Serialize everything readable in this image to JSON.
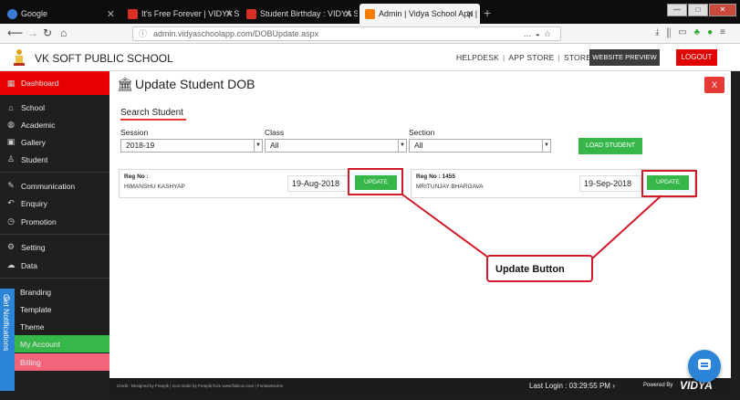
{
  "browser": {
    "tabs": [
      {
        "label": "Google",
        "color": "#3b79d6"
      },
      {
        "label": "It's Free Forever | VIDYA School",
        "color": "#d93025"
      },
      {
        "label": "Student Birthday : VIDYA SCHO",
        "color": "#d93025"
      },
      {
        "label": "Admin | Vidya School App | It's",
        "color": "#f57c00"
      }
    ],
    "new_tab": "+",
    "window_controls": [
      "—",
      "□",
      "✕"
    ],
    "url": "admin.vidyaschoolapp.com/DOBUpdate.aspx"
  },
  "header": {
    "school_name": "VK SOFT PUBLIC SCHOOL",
    "links": [
      "HELPDESK",
      "APP STORE",
      "STORE"
    ],
    "website_preview": "WEBSITE PREVIEW",
    "logout": "LOGOUT"
  },
  "sidebar": {
    "items": [
      {
        "label": "Dashboard",
        "icon": "dashboard-icon"
      },
      {
        "label": "School",
        "icon": "school-icon"
      },
      {
        "label": "Academic",
        "icon": "globe-icon"
      },
      {
        "label": "Gallery",
        "icon": "gallery-icon"
      },
      {
        "label": "Student",
        "icon": "student-icon"
      },
      {
        "label": "Communication",
        "icon": "communication-icon"
      },
      {
        "label": "Enquiry",
        "icon": "enquiry-icon"
      },
      {
        "label": "Promotion",
        "icon": "promotion-icon"
      },
      {
        "label": "Setting",
        "icon": "setting-icon"
      },
      {
        "label": "Data",
        "icon": "data-icon"
      },
      {
        "label": "Branding",
        "icon": "branding-icon"
      },
      {
        "label": "Template",
        "icon": "template-icon"
      },
      {
        "label": "Theme",
        "icon": "theme-icon"
      },
      {
        "label": "My Account",
        "icon": "account-icon"
      },
      {
        "label": "Billing",
        "icon": "billing-icon"
      }
    ],
    "notifications_tab": "Get Notifications"
  },
  "main": {
    "title": "Update Student DOB",
    "close_label": "X",
    "search_heading": "Search Student",
    "filters": {
      "session_label": "Session",
      "session_value": "2018-19",
      "class_label": "Class",
      "class_value": "All",
      "section_label": "Section",
      "section_value": "All"
    },
    "load_button": "LOAD STUDENT",
    "students": [
      {
        "reg_label": "Reg No :",
        "name": "HIMANSHU KASHYAP",
        "dob": "19-Aug-2018",
        "update_label": "UPDATE"
      },
      {
        "reg_label": "Reg No : 1455",
        "name": "MRITUNJAY BHARGAVA",
        "dob": "19-Sep-2018",
        "update_label": "UPDATE"
      }
    ],
    "callout_label": "Update Button"
  },
  "footer": {
    "credit": "Credit : Designed by Freepik | Icon made by Freepik from www.flaticon.com | Fontawesome",
    "last_login": "Last Login : 03:29:55 PM",
    "powered_by": "Powered By",
    "brand": "VIDYA"
  }
}
